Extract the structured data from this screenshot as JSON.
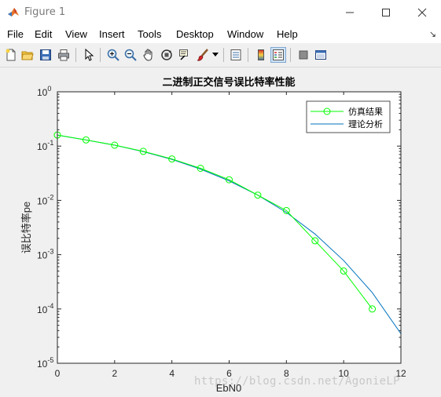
{
  "window": {
    "title": "Figure 1",
    "controls": [
      "minimize",
      "maximize",
      "close"
    ]
  },
  "menu": {
    "items": [
      "File",
      "Edit",
      "View",
      "Insert",
      "Tools",
      "Desktop",
      "Window",
      "Help"
    ]
  },
  "toolbar": {
    "buttons": [
      "new-figure-icon",
      "open-file-icon",
      "save-icon",
      "print-icon",
      "pointer-icon",
      "zoom-in-icon",
      "zoom-out-icon",
      "pan-icon",
      "rotate-3d-icon",
      "data-cursor-icon",
      "brush-icon",
      "link-plot-icon",
      "colorbar-icon",
      "legend-icon",
      "hide-plot-tools-icon",
      "show-plot-tools-icon"
    ]
  },
  "chart_data": {
    "type": "line",
    "title": "二进制正交信号误比特率性能",
    "xlabel": "EbN0",
    "ylabel": "误比特率pe",
    "xlim": [
      0,
      12
    ],
    "ylim": [
      1e-05,
      1
    ],
    "yscale": "log",
    "grid": false,
    "legend_position": "top-right",
    "x_ticks": [
      "0",
      "2",
      "4",
      "6",
      "8",
      "10",
      "12"
    ],
    "y_ticks": [
      "10",
      "10",
      "10",
      "10",
      "10",
      "10"
    ],
    "y_tick_exponents": [
      "-5",
      "-4",
      "-3",
      "-2",
      "-1",
      "0"
    ],
    "series": [
      {
        "name": "仿真结果",
        "color": "#00ff00",
        "marker": "circle",
        "x": [
          0,
          1,
          2,
          3,
          4,
          5,
          6,
          7,
          8,
          9,
          10,
          11
        ],
        "y": [
          0.16,
          0.13,
          0.104,
          0.08,
          0.058,
          0.039,
          0.024,
          0.0125,
          0.0065,
          0.0018,
          0.0005,
          0.0001
        ]
      },
      {
        "name": "理论分析",
        "color": "#0072bd",
        "marker": "none",
        "x": [
          0,
          1,
          2,
          3,
          4,
          5,
          6,
          7,
          8,
          9,
          10,
          11,
          12
        ],
        "y": [
          0.159,
          0.13,
          0.104,
          0.079,
          0.057,
          0.0377,
          0.0229,
          0.0125,
          0.006,
          0.0024,
          0.00078,
          0.0002,
          3.5e-05
        ]
      }
    ]
  },
  "watermark": "https://blog.csdn.net/AgonieLP"
}
